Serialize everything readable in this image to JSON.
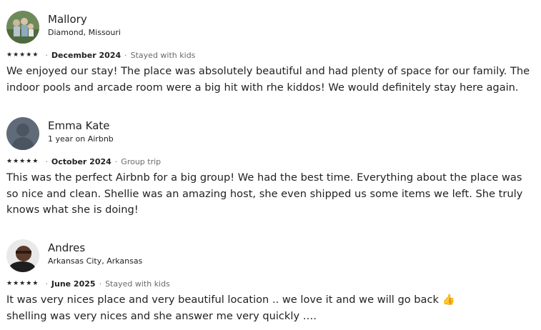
{
  "reviews": [
    {
      "name": "Mallory",
      "subtitle": "Diamond, Missouri",
      "rating": 5,
      "date": "December 2024",
      "tag": "Stayed with kids",
      "text": "We enjoyed our stay! The place was absolutely beautiful and had plenty of space for our family. The indoor pools and arcade room were a big hit with rhe kiddos! We would definitely stay here again."
    },
    {
      "name": "Emma Kate",
      "subtitle": "1 year on Airbnb",
      "rating": 5,
      "date": "October 2024",
      "tag": "Group trip",
      "text": "This was the perfect Airbnb for a big group! We had the best time. Everything about the place was so nice and clean. Shellie was an amazing host, she even shipped us some items we left. She truly knows what she is doing!"
    },
    {
      "name": "Andres",
      "subtitle": "Arkansas City, Arkansas",
      "rating": 5,
      "date": "June 2025",
      "tag": "Stayed with kids",
      "text": "It was very nices place and very beautiful  location  ..  we love it and we will go back 👍\n shelling was very nices and she answer me very quickly …."
    }
  ],
  "icons": {
    "star": "star-icon",
    "separator": "·"
  }
}
